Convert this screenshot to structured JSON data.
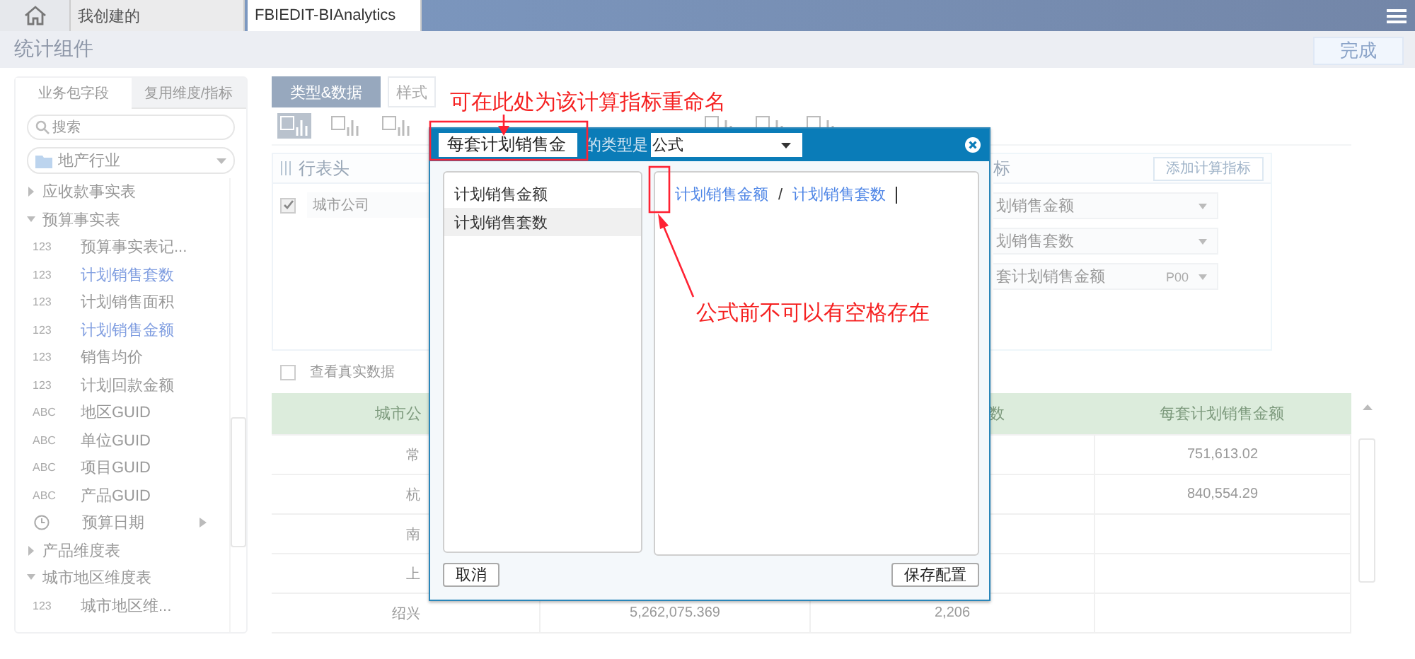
{
  "top_tabs": [
    {
      "kind": "home",
      "selected": false
    },
    {
      "kind": "tab",
      "label": "我创建的",
      "selected": false
    },
    {
      "kind": "tab",
      "label": "FBIEDIT-BIAnalytics",
      "selected": true
    }
  ],
  "header": {
    "title": "统计组件",
    "done_button": "完成"
  },
  "field_panel": {
    "tabs": [
      {
        "label": "业务包字段",
        "selected": true
      },
      {
        "label": "复用维度/指标",
        "selected": false
      }
    ],
    "search": {
      "placeholder": "搜索"
    },
    "package": "地产行业",
    "tree": [
      {
        "label": "应收款事实表",
        "expanded": false
      },
      {
        "label": "预算事实表",
        "expanded": true,
        "children": [
          {
            "kind": "field",
            "type_label": "123",
            "label": "预算事实表记...",
            "selected": false
          },
          {
            "kind": "field",
            "type_label": "123",
            "label": "计划销售套数",
            "selected": true
          },
          {
            "kind": "field",
            "type_label": "123",
            "label": "计划销售面积",
            "selected": false
          },
          {
            "kind": "field",
            "type_label": "123",
            "label": "计划销售金额",
            "selected": true
          },
          {
            "kind": "field",
            "type_label": "123",
            "label": "销售均价",
            "selected": false
          },
          {
            "kind": "field",
            "type_label": "123",
            "label": "计划回款金额",
            "selected": false
          },
          {
            "kind": "field",
            "type_label": "ABC",
            "label": "地区GUID",
            "selected": false
          },
          {
            "kind": "field",
            "type_label": "ABC",
            "label": "单位GUID",
            "selected": false
          },
          {
            "kind": "field",
            "type_label": "ABC",
            "label": "项目GUID",
            "selected": false
          },
          {
            "kind": "field",
            "type_label": "ABC",
            "label": "产品GUID",
            "selected": false
          },
          {
            "kind": "date",
            "label": "预算日期",
            "selected": false,
            "expanded": false
          }
        ]
      },
      {
        "label": "产品维度表",
        "expanded": false
      },
      {
        "label": "城市地区维度表",
        "expanded": true,
        "children": [
          {
            "kind": "field",
            "type_label": "123",
            "label": "城市地区维...",
            "selected": false
          }
        ]
      }
    ]
  },
  "editor_tabs": [
    {
      "label": "类型&数据",
      "selected": true
    },
    {
      "label": "样式",
      "selected": false
    }
  ],
  "chart_types": [
    {
      "selected": true
    },
    {
      "selected": false
    },
    {
      "selected": false
    },
    {
      "selected": false
    },
    {
      "selected": false
    },
    {
      "selected": false
    }
  ],
  "row_header": {
    "title": "行表头",
    "items": [
      {
        "label": "城市公司",
        "checked": true
      }
    ]
  },
  "indicators": {
    "title": "标",
    "add_button": "添加计算指标",
    "items": [
      {
        "label": "划销售金额"
      },
      {
        "label": "划销售套数"
      },
      {
        "label": "套计划销售金额",
        "format": "P00"
      }
    ]
  },
  "real_data": {
    "label": "查看真实数据",
    "checked": false
  },
  "table": {
    "columns": {
      "column_1": "城市公",
      "column_3": "数",
      "column_4": "每套计划销售金额"
    },
    "rows": [
      {
        "column_1": "常",
        "column_4": "751,613.02"
      },
      {
        "column_1": "杭",
        "column_4": "840,554.29"
      },
      {
        "column_1": "南"
      },
      {
        "column_1": "上"
      },
      {
        "column_1": "绍兴",
        "column_2": "5,262,075.369",
        "column_3": "2,206"
      }
    ]
  },
  "dialog": {
    "name_field": {
      "value": "每套计划销售金"
    },
    "type_label": "的类型是",
    "type_select": "公式",
    "fields": [
      {
        "label": "计划销售金额",
        "selected": false
      },
      {
        "label": "计划销售套数",
        "selected": true
      }
    ],
    "formula": [
      {
        "kind": "field",
        "text": "计划销售金额"
      },
      {
        "kind": "operator",
        "text": "/"
      },
      {
        "kind": "field",
        "text": "计划销售套数"
      }
    ],
    "cancel_button": "取消",
    "save_button": "保存配置"
  },
  "annotations": [
    {
      "kind": "callout",
      "text": "可在此处为该计算指标重命名"
    },
    {
      "kind": "callout",
      "text": "公式前不可以有空格存在"
    }
  ]
}
